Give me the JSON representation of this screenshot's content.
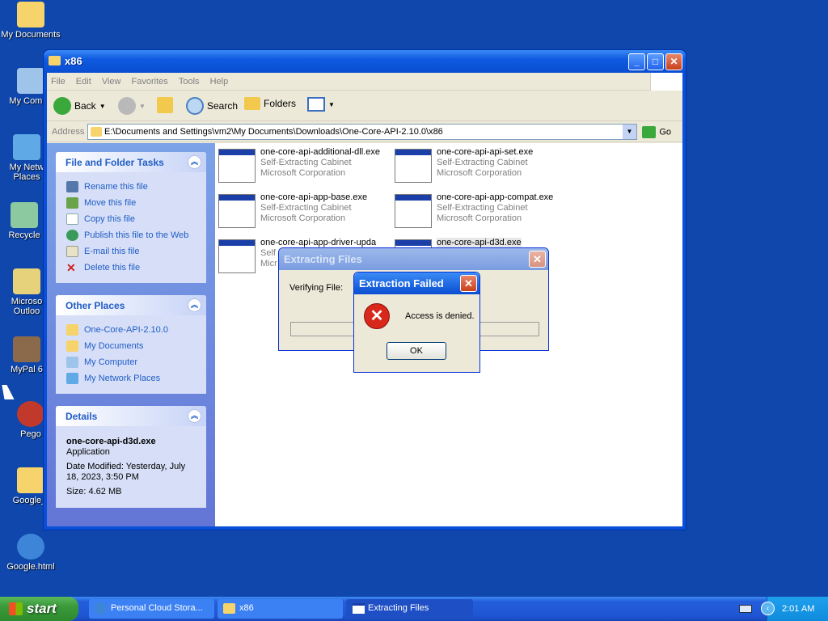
{
  "desktop": {
    "icons": [
      {
        "label": "My Documents",
        "icon": "folder-docs-icon",
        "color": "#f7d36b"
      },
      {
        "label": "My Compu",
        "icon": "computer-icon",
        "color": "#9fc4ea"
      },
      {
        "label": "My Netw Places",
        "icon": "network-icon",
        "color": "#5fa9e6"
      },
      {
        "label": "Recycle",
        "icon": "recycle-bin-icon",
        "color": "#8cc9a0"
      },
      {
        "label": "Microso Outloo",
        "icon": "outlook-icon",
        "color": "#e6d27a"
      },
      {
        "label": "MyPal 6",
        "icon": "raccoon-icon",
        "color": "#8a6a4a"
      },
      {
        "label": "Pego",
        "icon": "pego-icon",
        "color": "#c0392b"
      },
      {
        "label": "Google_f",
        "icon": "folder-icon",
        "color": "#f7d36b"
      },
      {
        "label": "Google.html",
        "icon": "ie-html-icon",
        "color": "#3d85d8"
      }
    ]
  },
  "window": {
    "title": "x86",
    "menu": [
      "File",
      "Edit",
      "View",
      "Favorites",
      "Tools",
      "Help"
    ],
    "toolbar": {
      "back": "Back",
      "search": "Search",
      "folders": "Folders"
    },
    "address": {
      "label": "Address",
      "path": "E:\\Documents and Settings\\vm2\\My Documents\\Downloads\\One-Core-API-2.10.0\\x86",
      "go": "Go"
    },
    "tasks": {
      "title": "File and Folder Tasks",
      "items": [
        "Rename this file",
        "Move this file",
        "Copy this file",
        "Publish this file to the Web",
        "E-mail this file",
        "Delete this file"
      ]
    },
    "other_places": {
      "title": "Other Places",
      "items": [
        "One-Core-API-2.10.0",
        "My Documents",
        "My Computer",
        "My Network Places"
      ]
    },
    "details": {
      "title": "Details",
      "name": "one-core-api-d3d.exe",
      "type": "Application",
      "modified": "Date Modified: Yesterday, July 18, 2023, 3:50 PM",
      "size": "Size: 4.62 MB"
    },
    "files": [
      {
        "name": "one-core-api-additional-dll.exe",
        "type": "Self-Extracting Cabinet",
        "company": "Microsoft Corporation"
      },
      {
        "name": "one-core-api-api-set.exe",
        "type": "Self-Extracting Cabinet",
        "company": "Microsoft Corporation"
      },
      {
        "name": "one-core-api-app-base.exe",
        "type": "Self-Extracting Cabinet",
        "company": "Microsoft Corporation"
      },
      {
        "name": "one-core-api-app-compat.exe",
        "type": "Self-Extracting Cabinet",
        "company": "Microsoft Corporation"
      },
      {
        "name": "one-core-api-app-driver-upda",
        "type": "Self",
        "company": "Micr"
      },
      {
        "name": "one-core-api-d3d.exe",
        "type": "",
        "company": ""
      }
    ]
  },
  "extract_dialog": {
    "title": "Extracting Files",
    "label": "Verifying File:"
  },
  "error_dialog": {
    "title": "Extraction Failed",
    "message": "Access is denied.",
    "ok": "OK"
  },
  "taskbar": {
    "start": "start",
    "tasks": [
      "Personal Cloud Stora...",
      "x86",
      "Extracting Files"
    ],
    "clock": "2:01 AM"
  }
}
